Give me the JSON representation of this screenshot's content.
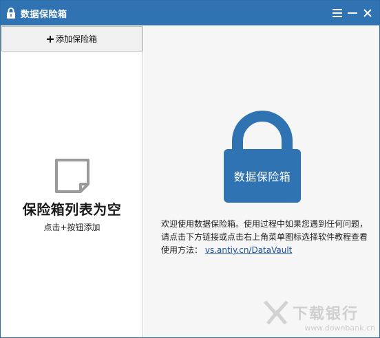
{
  "window": {
    "title": "数据保险箱",
    "title_icon": "lock-icon",
    "controls": [
      "menu-icon",
      "minimize-icon",
      "close-icon"
    ]
  },
  "left_pane": {
    "add_button_label": "添加保险箱",
    "add_button_icon": "plus-icon",
    "empty_icon": "empty-document-icon",
    "empty_title": "保险箱列表为空",
    "empty_hint": "点击+按钮添加"
  },
  "right_pane": {
    "lock_label": "数据保险箱",
    "lock_icon": "padlock-icon",
    "description": "欢迎使用数据保险箱。使用过程中如果您遇到任何问题，请点击下方链接或点击右上角菜单图标选择软件教程查看使用方法：",
    "link_text": "vs.antiy.cn/DataVault"
  },
  "watermark": {
    "text": "下载银行",
    "url": "www.downbank.cn"
  },
  "colors": {
    "titlebar": "#2f73b2",
    "lock": "#2f73b2",
    "link": "#1a4f9c"
  }
}
